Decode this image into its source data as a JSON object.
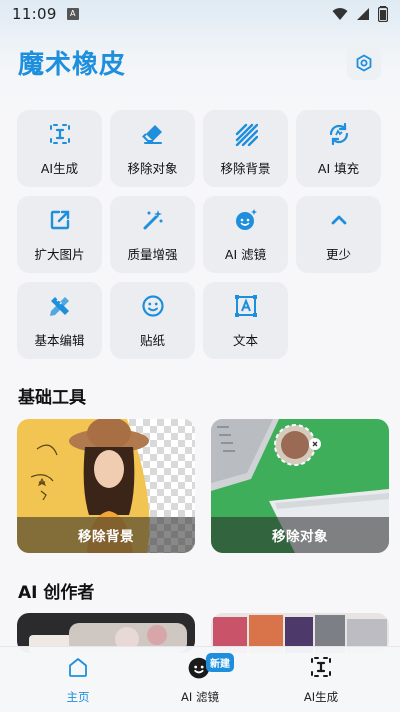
{
  "status_bar": {
    "time": "11:09",
    "indicator": "A"
  },
  "header": {
    "title": "魔术橡皮",
    "settings_icon": "settings-hexagon-icon"
  },
  "tools": [
    {
      "label": "AI生成",
      "icon": "ai-text-icon"
    },
    {
      "label": "移除对象",
      "icon": "eraser-icon"
    },
    {
      "label": "移除背景",
      "icon": "stripes-icon"
    },
    {
      "label": "AI 填充",
      "icon": "fill-refresh-icon"
    },
    {
      "label": "扩大图片",
      "icon": "expand-icon"
    },
    {
      "label": "质量增强",
      "icon": "magic-wand-icon"
    },
    {
      "label": "AI 滤镜",
      "icon": "face-sparkle-icon"
    },
    {
      "label": "更少",
      "icon": "chevron-up-icon"
    },
    {
      "label": "基本编辑",
      "icon": "pencil-ruler-icon"
    },
    {
      "label": "贴纸",
      "icon": "smiley-icon"
    },
    {
      "label": "文本",
      "icon": "text-frame-icon"
    }
  ],
  "sections": {
    "basic_tools": "基础工具",
    "ai_creator": "AI 创作者"
  },
  "cards": {
    "remove_background": "移除背景",
    "remove_object": "移除对象"
  },
  "nav": {
    "home": "主页",
    "ai_filter": "AI 滤镜",
    "ai_filter_badge": "新建",
    "ai_generate": "AI生成"
  },
  "colors": {
    "accent": "#1e8fdc",
    "tile_bg": "#ebedf0",
    "card_green": "#3fae5a",
    "card_yellow": "#f3c54b"
  }
}
